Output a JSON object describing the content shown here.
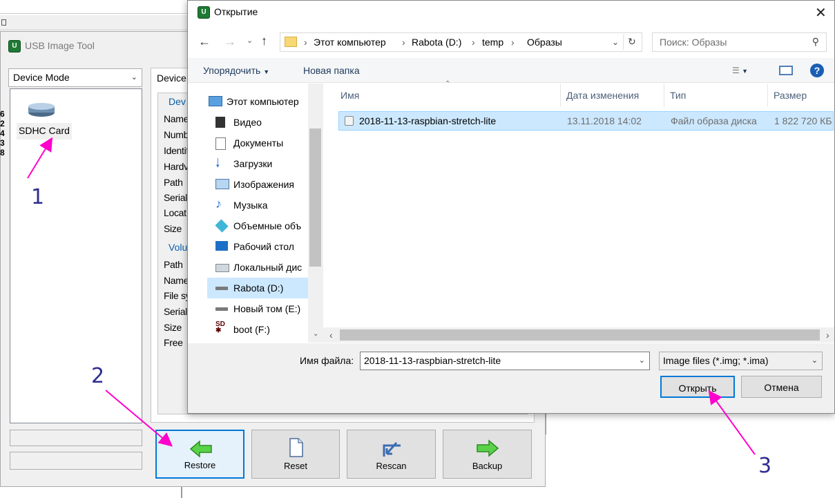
{
  "usb_tool": {
    "title": "USB Image Tool",
    "mode_select": "Device Mode",
    "device": {
      "label": "SDHC Card"
    },
    "tab_label": "Device",
    "device_group": "Dev",
    "device_fields": [
      "Name",
      "Numb",
      "Identif",
      "Hardv",
      "Path",
      "Serial",
      "Locat",
      "Size"
    ],
    "volume_group": "Volu",
    "volume_fields": [
      "Path",
      "Name",
      "File sy",
      "Serial",
      "Size",
      "Free"
    ],
    "left_edge_chars": [
      "6",
      "2",
      "4",
      "3",
      "8"
    ],
    "buttons": {
      "restore": "Restore",
      "reset": "Reset",
      "rescan": "Rescan",
      "backup": "Backup"
    }
  },
  "dialog": {
    "title": "Открытие",
    "breadcrumb": [
      "Этот компьютер",
      "Rabota (D:)",
      "temp",
      "Образы"
    ],
    "search_placeholder": "Поиск: Образы",
    "organize": "Упорядочить",
    "new_folder": "Новая папка",
    "nav_items": [
      {
        "label": "Этот компьютер",
        "icon": "computer-icon"
      },
      {
        "label": "Видео",
        "icon": "video-icon"
      },
      {
        "label": "Документы",
        "icon": "documents-icon"
      },
      {
        "label": "Загрузки",
        "icon": "downloads-icon"
      },
      {
        "label": "Изображения",
        "icon": "pictures-icon"
      },
      {
        "label": "Музыка",
        "icon": "music-icon"
      },
      {
        "label": "Объемные объ",
        "icon": "3d-objects-icon"
      },
      {
        "label": "Рабочий стол",
        "icon": "desktop-icon"
      },
      {
        "label": "Локальный дис",
        "icon": "local-disk-icon"
      },
      {
        "label": "Rabota (D:)",
        "icon": "drive-icon"
      },
      {
        "label": "Новый том (E:)",
        "icon": "drive-icon"
      },
      {
        "label": "boot (F:)",
        "icon": "sd-card-icon"
      }
    ],
    "columns": {
      "name": "Имя",
      "date": "Дата изменения",
      "type": "Тип",
      "size": "Размер"
    },
    "files": [
      {
        "name": "2018-11-13-raspbian-stretch-lite",
        "date": "13.11.2018 14:02",
        "type": "Файл образа диска",
        "size": "1 822 720 КБ"
      }
    ],
    "filename_label": "Имя файла:",
    "filename_value": "2018-11-13-raspbian-stretch-lite",
    "filter": "Image files (*.img; *.ima)",
    "open_button": "Открыть",
    "cancel_button": "Отмена"
  },
  "annotations": {
    "one": "1",
    "two": "2",
    "three": "3",
    "color": "#ff00cc"
  }
}
